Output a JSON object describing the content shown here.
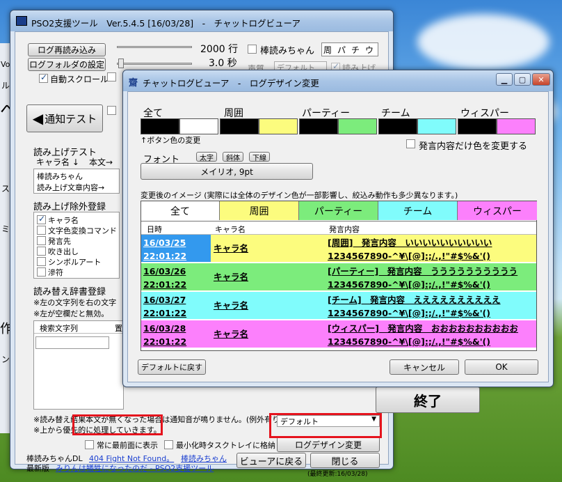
{
  "main_window": {
    "title": "PSO2支援ツール　Ver.5.4.5 [16/03/28]　-　チャットログビューア",
    "reload_button": "ログ再読み込み",
    "log_folder_button": "ログフォルダの設定",
    "auto_scroll_label": "自動スクロール",
    "line_count": "2000 行",
    "seconds": "3.0 秒",
    "bouyomi_label": "棒読みちゃん",
    "tabs": [
      "周",
      "パ",
      "チ",
      "ウ"
    ],
    "voice_label": "声質",
    "voice_value": "デフォルト",
    "read_label": "読み上げ",
    "notify_test_button": "通知テスト",
    "read_test_header": "読み上げテスト",
    "char_name_col": "キャラ名 ↓",
    "body_col": "本文→",
    "read_char_value": "棒読みちゃん",
    "read_body_value": "読み上げ文章内容→",
    "exclusion_header": "読み上げ除外登録",
    "exclusion_items": [
      {
        "label": "キャラ名",
        "checked": true
      },
      {
        "label": "文字色変換コマンド",
        "checked": false
      },
      {
        "label": "発言先",
        "checked": false
      },
      {
        "label": "吹き出し",
        "checked": false
      },
      {
        "label": "シンボルアート",
        "checked": false
      },
      {
        "label": "滲符",
        "checked": false
      }
    ],
    "dict_header": "読み替え辞書登録",
    "dict_note1": "※左の文字列を右の文字",
    "dict_note2": "※左が空欄だと無効。",
    "dict_col1": "検索文字列",
    "dict_col2": "置",
    "note_line1": "※読み替え結果本文が無くなった場合は通知音が鳴りません。(例外有り)",
    "note_line2": "※上から優先的に処理していきます。",
    "default_dropdown": "デフォルト",
    "always_top_label": "常に最前面に表示",
    "tray_label": "最小化時タスクトレイに格納",
    "log_design_button": "ログデザイン変更",
    "footer_label1": "棒読みちゃんDL",
    "footer_link1": "404 Fight Not Found。",
    "footer_link1b": "棒読みちゃん",
    "footer_label2": "最新版",
    "footer_link2": "みりんは犠牲になったのだ - PSO2支援ツール",
    "back_viewer_button": "ビューアに戻る",
    "close_button": "閉じる",
    "last_update": "(最終更新:16/03/28)",
    "end_button": "終了",
    "left_edge_labels": [
      "Vo",
      "ル",
      "へ",
      "ス",
      "ミ",
      "作",
      "ン"
    ]
  },
  "dialog": {
    "title": "チャットログビューア　-　ログデザイン変更",
    "categories": [
      "全て",
      "周囲",
      "パーティー",
      "チーム",
      "ウィスパー"
    ],
    "button_color_note": "↑ボタン色の変更",
    "font_label": "フォント",
    "bold_btn": "太字",
    "italic_btn": "斜体",
    "underline_btn": "下線",
    "font_button": "メイリオ, 9pt",
    "only_text_color_label": "発言内容だけ色を変更する",
    "preview_label": "変更後のイメージ (実際には全体のデザイン色が一部影響し、絞込み動作も多少異なります。)",
    "preview_tabs": [
      "全て",
      "周囲",
      "パーティー",
      "チーム",
      "ウィスパー"
    ],
    "table_headers": [
      "日時",
      "キャラ名",
      "発言内容"
    ],
    "rows": [
      {
        "date": "16/03/25",
        "time": "22:01:22",
        "name": "キャラ名",
        "line1": "[周囲]　発言内容　いいいいいいいいいい",
        "line2": "1234567890-^¥\\[@]:;/.,!\"#$%&'()"
      },
      {
        "date": "16/03/26",
        "time": "22:01:22",
        "name": "キャラ名",
        "line1": "[パーティー]　発言内容　うううううううううう",
        "line2": "1234567890-^¥\\[@]:;/.,!\"#$%&'()"
      },
      {
        "date": "16/03/27",
        "time": "22:01:22",
        "name": "キャラ名",
        "line1": "[チーム]　発言内容　ええええええええええ",
        "line2": "1234567890-^¥\\[@]:;/.,!\"#$%&'()"
      },
      {
        "date": "16/03/28",
        "time": "22:01:22",
        "name": "キャラ名",
        "line1": "[ウィスパー]　発言内容　おおおおおおおおおお",
        "line2": "1234567890-^¥\\[@]:;/.,!\"#$%&'()"
      }
    ],
    "default_button": "デフォルトに戻す",
    "cancel_button": "キャンセル",
    "ok_button": "OK"
  },
  "colors": {
    "yellow": "#fcfc7e",
    "green": "#7cec7c",
    "cyan": "#80fcfc",
    "pink": "#fc80fc",
    "selected": "#3399ee",
    "highlight_red": "#e5131d"
  }
}
